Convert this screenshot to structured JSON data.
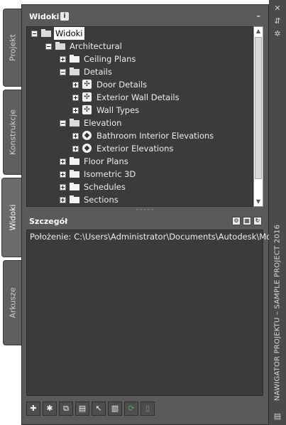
{
  "tabs": [
    {
      "label": "Projekt",
      "active": false
    },
    {
      "label": "Konstrukcje",
      "active": false
    },
    {
      "label": "Widoki",
      "active": true
    },
    {
      "label": "Arkusze",
      "active": false
    }
  ],
  "palette_title": "NAWIGATOR PROJEKTU – SAMPLE PROJECT 2016",
  "views_panel": {
    "title": "Widoki",
    "info_icon": "info-icon",
    "collapse": "–"
  },
  "tree": [
    {
      "label": "Widoki",
      "type": "folder-open",
      "expand": "−"
    },
    {
      "label": "Architectural",
      "type": "folder-open",
      "expand": "−"
    },
    {
      "label": "Ceiling Plans",
      "type": "folder",
      "expand": "+"
    },
    {
      "label": "Details",
      "type": "folder-open",
      "expand": "−"
    },
    {
      "label": "Door Details",
      "type": "view",
      "expand": "+"
    },
    {
      "label": "Exterior Wall Details",
      "type": "view",
      "expand": "+"
    },
    {
      "label": "Wall Types",
      "type": "view",
      "expand": "+"
    },
    {
      "label": "Elevation",
      "type": "folder-open",
      "expand": "−"
    },
    {
      "label": "Bathroom Interior Elevations",
      "type": "elev",
      "expand": "+"
    },
    {
      "label": "Exterior Elevations",
      "type": "elev",
      "expand": "+"
    },
    {
      "label": "Floor Plans",
      "type": "folder",
      "expand": "+"
    },
    {
      "label": "Isometric 3D",
      "type": "folder",
      "expand": "+"
    },
    {
      "label": "Schedules",
      "type": "folder",
      "expand": "+"
    },
    {
      "label": "Sections",
      "type": "folder",
      "expand": "+"
    }
  ],
  "detail_panel": {
    "title": "Szczegół",
    "path": "Położenie: C:\\Users\\Administrator\\Documents\\Autodesk\\Moje"
  },
  "colors": {
    "panel": "#5a5a5a",
    "tree_bg": "#3b3b3b",
    "accent_green": "#3cb043"
  }
}
